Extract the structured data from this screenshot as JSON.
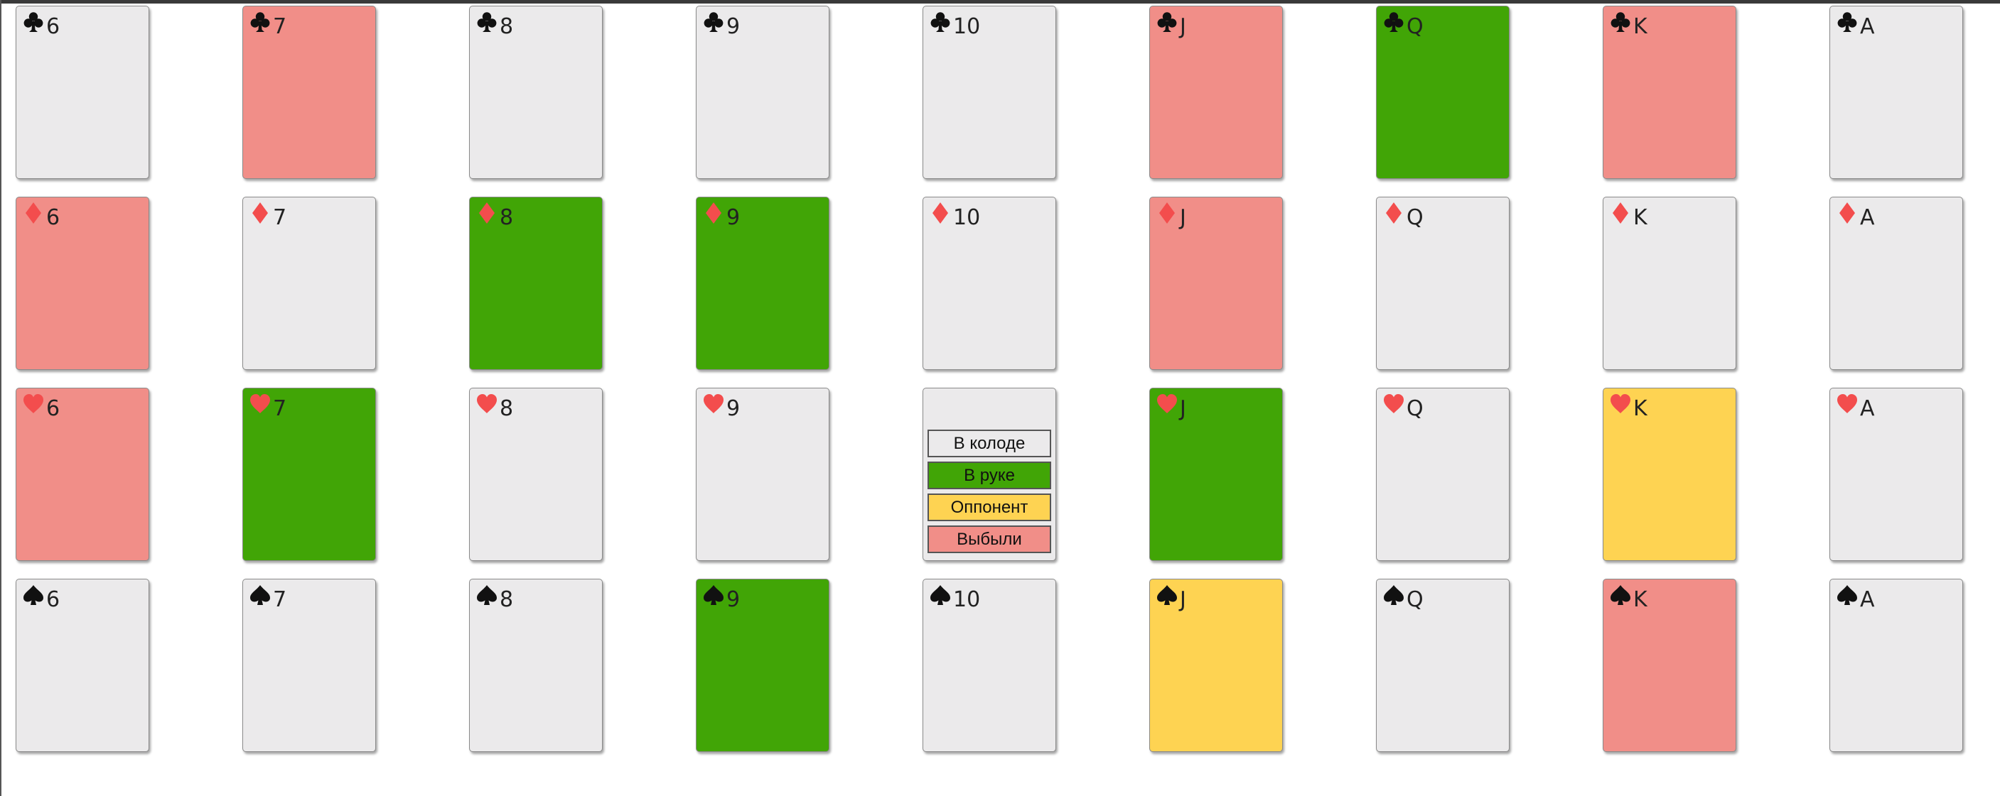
{
  "suits": {
    "clubs": {
      "icon": "clubs-icon",
      "color": "#111111"
    },
    "diamonds": {
      "icon": "diamonds-icon",
      "color": "#f34d4d"
    },
    "hearts": {
      "icon": "hearts-icon",
      "color": "#f34d4d"
    },
    "spades": {
      "icon": "spades-icon",
      "color": "#111111"
    }
  },
  "status_colors": {
    "deck": "#ebeaeb",
    "hand": "#41a506",
    "opponent": "#fed352",
    "out": "#f18e88"
  },
  "legend": {
    "deck_label": "В колоде",
    "hand_label": "В руке",
    "opponent_label": "Оппонент",
    "out_label": "Выбыли"
  },
  "rows": [
    {
      "suit": "clubs",
      "cards": [
        {
          "rank": "6",
          "status": "deck"
        },
        {
          "rank": "7",
          "status": "out"
        },
        {
          "rank": "8",
          "status": "deck"
        },
        {
          "rank": "9",
          "status": "deck"
        },
        {
          "rank": "10",
          "status": "deck"
        },
        {
          "rank": "J",
          "status": "out"
        },
        {
          "rank": "Q",
          "status": "hand"
        },
        {
          "rank": "K",
          "status": "out"
        },
        {
          "rank": "A",
          "status": "deck"
        }
      ]
    },
    {
      "suit": "diamonds",
      "cards": [
        {
          "rank": "6",
          "status": "out"
        },
        {
          "rank": "7",
          "status": "deck"
        },
        {
          "rank": "8",
          "status": "hand"
        },
        {
          "rank": "9",
          "status": "hand"
        },
        {
          "rank": "10",
          "status": "deck"
        },
        {
          "rank": "J",
          "status": "out"
        },
        {
          "rank": "Q",
          "status": "deck"
        },
        {
          "rank": "K",
          "status": "deck"
        },
        {
          "rank": "A",
          "status": "deck"
        }
      ]
    },
    {
      "suit": "hearts",
      "cards": [
        {
          "rank": "6",
          "status": "out"
        },
        {
          "rank": "7",
          "status": "hand"
        },
        {
          "rank": "8",
          "status": "deck"
        },
        {
          "rank": "9",
          "status": "deck"
        },
        {
          "rank": "",
          "status": "legend"
        },
        {
          "rank": "J",
          "status": "hand"
        },
        {
          "rank": "Q",
          "status": "deck"
        },
        {
          "rank": "K",
          "status": "opponent"
        },
        {
          "rank": "A",
          "status": "deck"
        }
      ]
    },
    {
      "suit": "spades",
      "cards": [
        {
          "rank": "6",
          "status": "deck"
        },
        {
          "rank": "7",
          "status": "deck"
        },
        {
          "rank": "8",
          "status": "deck"
        },
        {
          "rank": "9",
          "status": "hand"
        },
        {
          "rank": "10",
          "status": "deck"
        },
        {
          "rank": "J",
          "status": "opponent"
        },
        {
          "rank": "Q",
          "status": "deck"
        },
        {
          "rank": "K",
          "status": "out"
        },
        {
          "rank": "A",
          "status": "deck"
        }
      ]
    }
  ]
}
